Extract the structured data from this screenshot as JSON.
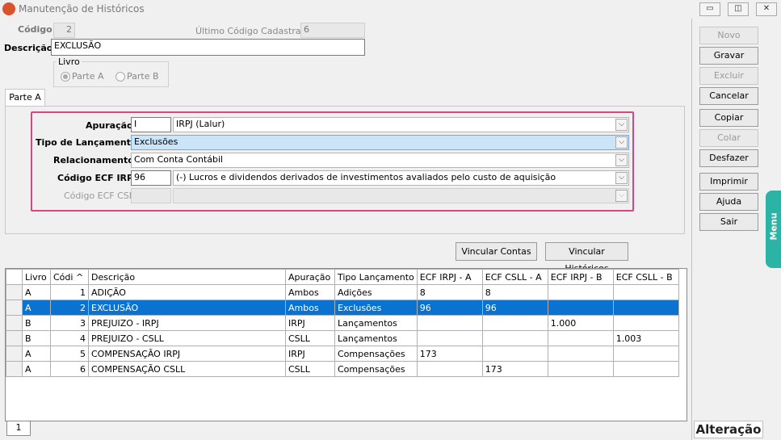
{
  "window": {
    "title": "Manutenção de Históricos"
  },
  "form": {
    "codigo_label": "Código",
    "codigo_value": "2",
    "ultimo_label": "Último Código Cadastrado:",
    "ultimo_value": "6",
    "descricao_label": "Descrição",
    "descricao_value": "EXCLUSÃO",
    "livro_label": "Livro",
    "parte_a": "Parte A",
    "parte_b": "Parte B"
  },
  "tab": {
    "label": "Parte A"
  },
  "panel": {
    "apuracao_label": "Apuração",
    "apuracao_code": "I",
    "apuracao_value": "IRPJ (Lalur)",
    "tipo_label": "Tipo de Lançamento",
    "tipo_value": "Exclusões",
    "relac_label": "Relacionamento",
    "relac_value": "Com Conta Contábil",
    "ecf_irpj_label": "Código ECF IRPJ",
    "ecf_irpj_code": "96",
    "ecf_irpj_value": "(-) Lucros e dividendos derivados de investimentos avaliados pelo custo de aquisição",
    "ecf_csll_label": "Código ECF CSLL"
  },
  "buttons": {
    "vincular_contas": "Vincular Contas",
    "vincular_historicos": "Vincular Históricos"
  },
  "side": {
    "novo": "Novo",
    "gravar": "Gravar",
    "excluir": "Excluir",
    "cancelar": "Cancelar",
    "copiar": "Copiar",
    "colar": "Colar",
    "desfazer": "Desfazer",
    "imprimir": "Imprimir",
    "ajuda": "Ajuda",
    "sair": "Sair",
    "menu": "Menu",
    "mode": "Alteração"
  },
  "grid": {
    "headers": [
      "Livro",
      "Códi ^",
      "Descrição",
      "Apuração",
      "Tipo Lançamento",
      "ECF IRPJ - A",
      "ECF CSLL - A",
      "ECF IRPJ - B",
      "ECF CSLL - B"
    ],
    "rows": [
      [
        "A",
        "1",
        "ADIÇÃO",
        "Ambos",
        "Adições",
        "8",
        "8",
        "",
        ""
      ],
      [
        "A",
        "2",
        "EXCLUSÃO",
        "Ambos",
        "Exclusões",
        "96",
        "96",
        "",
        ""
      ],
      [
        "B",
        "3",
        "PREJUIZO - IRPJ",
        "IRPJ",
        "Lançamentos",
        "",
        "",
        "1.000",
        ""
      ],
      [
        "B",
        "4",
        "PREJUIZO - CSLL",
        "CSLL",
        "Lançamentos",
        "",
        "",
        "",
        "1.003"
      ],
      [
        "A",
        "5",
        "COMPENSAÇÃO IRPJ",
        "IRPJ",
        "Compensações",
        "173",
        "",
        "",
        ""
      ],
      [
        "A",
        "6",
        "COMPENSAÇÃO CSLL",
        "CSLL",
        "Compensações",
        "",
        "173",
        "",
        ""
      ]
    ],
    "page_tab": "1"
  }
}
